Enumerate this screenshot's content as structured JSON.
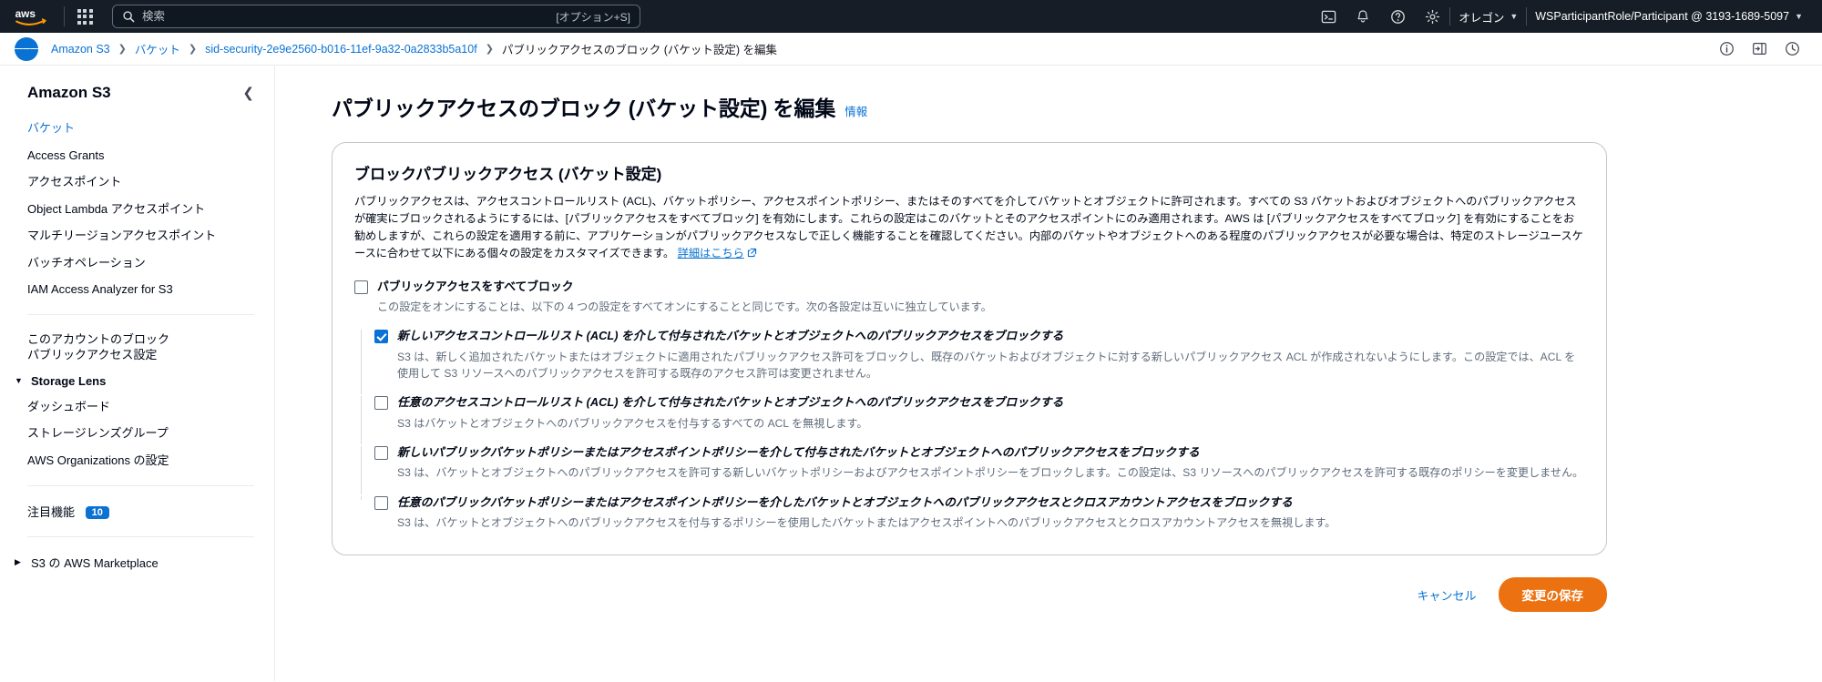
{
  "topnav": {
    "logo_alt": "aws",
    "apps_icon": "apps-grid-icon",
    "search": {
      "placeholder": "検索",
      "value": "",
      "shortcut": "[オプション+S]",
      "icon": "search-icon"
    },
    "icons": [
      {
        "name": "cloudshell-icon",
        "label": "CloudShell"
      },
      {
        "name": "bell-icon",
        "label": "通知"
      },
      {
        "name": "help-icon",
        "label": "ヘルプ"
      },
      {
        "name": "gear-icon",
        "label": "設定"
      }
    ],
    "region": "オレゴン",
    "account": "WSParticipantRole/Participant @ 3193-1689-5097"
  },
  "breadcrumb": {
    "menu_icon": "hamburger-menu-icon",
    "items": [
      {
        "label": "Amazon S3",
        "link": true
      },
      {
        "label": "バケット",
        "link": true
      },
      {
        "label": "sid-security-2e9e2560-b016-11ef-9a32-0a2833b5a10f",
        "link": true
      },
      {
        "label": "パブリックアクセスのブロック (バケット設定) を編集",
        "link": false
      }
    ],
    "separator": "❯",
    "right_icons": [
      {
        "name": "info-circle-icon"
      },
      {
        "name": "open-panel-icon"
      },
      {
        "name": "history-clock-icon"
      }
    ]
  },
  "sidebar": {
    "title": "Amazon S3",
    "collapse_icon": "chevron-left-icon",
    "items": [
      {
        "label": "バケット",
        "active": true
      },
      {
        "label": "Access Grants",
        "active": false
      },
      {
        "label": "アクセスポイント",
        "active": false
      },
      {
        "label": "Object Lambda アクセスポイント",
        "active": false
      },
      {
        "label": "マルチリージョンアクセスポイント",
        "active": false
      },
      {
        "label": "バッチオペレーション",
        "active": false
      },
      {
        "label": "IAM Access Analyzer for S3",
        "active": false
      }
    ],
    "account_setting": "このアカウントのブロックパブリックアクセス設定",
    "storage_lens": {
      "label": "Storage Lens",
      "expanded": true,
      "items": [
        {
          "label": "ダッシュボード"
        },
        {
          "label": "ストレージレンズグループ"
        },
        {
          "label": "AWS Organizations の設定"
        }
      ]
    },
    "featured": {
      "label": "注目機能",
      "badge": "10"
    },
    "marketplace": {
      "label": "S3 の AWS Marketplace",
      "expanded": false
    }
  },
  "main": {
    "page_title": "パブリックアクセスのブロック (バケット設定) を編集",
    "info_label": "情報",
    "panel": {
      "title": "ブロックパブリックアクセス (バケット設定)",
      "description": "パブリックアクセスは、アクセスコントロールリスト (ACL)、バケットポリシー、アクセスポイントポリシー、またはそのすべてを介してバケットとオブジェクトに許可されます。すべての S3 バケットおよびオブジェクトへのパブリックアクセスが確実にブロックされるようにするには、[パブリックアクセスをすべてブロック] を有効にします。これらの設定はこのバケットとそのアクセスポイントにのみ適用されます。AWS は [パブリックアクセスをすべてブロック] を有効にすることをお勧めしますが、これらの設定を適用する前に、アプリケーションがパブリックアクセスなしで正しく機能することを確認してください。内部のバケットやオブジェクトへのある程度のパブリックアクセスが必要な場合は、特定のストレージユースケースに合わせて以下にある個々の設定をカスタマイズできます。",
      "learn_more": "詳細はこちら",
      "options": [
        {
          "label": "パブリックアクセスをすべてブロック",
          "checked": false,
          "help": "この設定をオンにすることは、以下の 4 つの設定をすべてオンにすることと同じです。次の各設定は互いに独立しています。",
          "sub": false,
          "style": "bold"
        },
        {
          "label": "新しいアクセスコントロールリスト (ACL) を介して付与されたバケットとオブジェクトへのパブリックアクセスをブロックする",
          "checked": true,
          "help": "S3 は、新しく追加されたバケットまたはオブジェクトに適用されたパブリックアクセス許可をブロックし、既存のバケットおよびオブジェクトに対する新しいパブリックアクセス ACL が作成されないようにします。この設定では、ACL を使用して S3 リソースへのパブリックアクセスを許可する既存のアクセス許可は変更されません。",
          "sub": true,
          "style": "bold-italic"
        },
        {
          "label": "任意のアクセスコントロールリスト (ACL) を介して付与されたバケットとオブジェクトへのパブリックアクセスをブロックする",
          "checked": false,
          "help": "S3 はバケットとオブジェクトへのパブリックアクセスを付与するすべての ACL を無視します。",
          "sub": true,
          "style": "bold-italic"
        },
        {
          "label": "新しいパブリックバケットポリシーまたはアクセスポイントポリシーを介して付与されたバケットとオブジェクトへのパブリックアクセスをブロックする",
          "checked": false,
          "help": "S3 は、バケットとオブジェクトへのパブリックアクセスを許可する新しいバケットポリシーおよびアクセスポイントポリシーをブロックします。この設定は、S3 リソースへのパブリックアクセスを許可する既存のポリシーを変更しません。",
          "sub": true,
          "style": "bold-italic"
        },
        {
          "label": "任意のパブリックバケットポリシーまたはアクセスポイントポリシーを介したバケットとオブジェクトへのパブリックアクセスとクロスアカウントアクセスをブロックする",
          "checked": false,
          "help": "S3 は、バケットとオブジェクトへのパブリックアクセスを付与するポリシーを使用したバケットまたはアクセスポイントへのパブリックアクセスとクロスアカウントアクセスを無視します。",
          "sub": true,
          "style": "bold-italic"
        }
      ]
    },
    "actions": {
      "cancel": "キャンセル",
      "save": "変更の保存"
    }
  },
  "colors": {
    "nav_bg": "#161d26",
    "link": "#0972d3",
    "primary_button": "#ec7211",
    "checkbox_checked": "#0972d3",
    "badge": "#0972d3"
  }
}
